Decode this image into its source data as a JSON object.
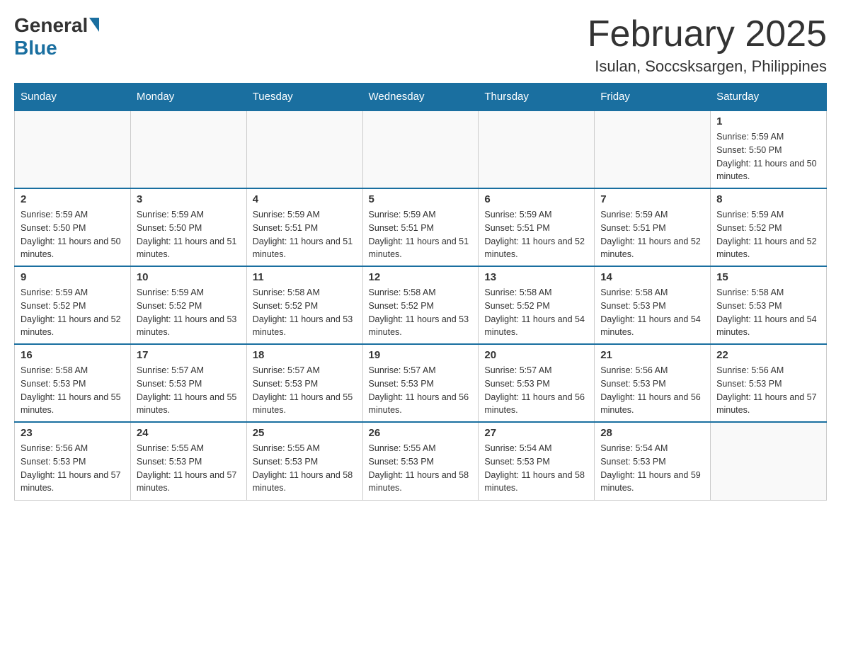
{
  "header": {
    "logo_general": "General",
    "logo_blue": "Blue",
    "month_title": "February 2025",
    "location": "Isulan, Soccsksargen, Philippines"
  },
  "calendar": {
    "days_of_week": [
      "Sunday",
      "Monday",
      "Tuesday",
      "Wednesday",
      "Thursday",
      "Friday",
      "Saturday"
    ],
    "weeks": [
      [
        {
          "day": "",
          "info": ""
        },
        {
          "day": "",
          "info": ""
        },
        {
          "day": "",
          "info": ""
        },
        {
          "day": "",
          "info": ""
        },
        {
          "day": "",
          "info": ""
        },
        {
          "day": "",
          "info": ""
        },
        {
          "day": "1",
          "sunrise": "Sunrise: 5:59 AM",
          "sunset": "Sunset: 5:50 PM",
          "daylight": "Daylight: 11 hours and 50 minutes."
        }
      ],
      [
        {
          "day": "2",
          "sunrise": "Sunrise: 5:59 AM",
          "sunset": "Sunset: 5:50 PM",
          "daylight": "Daylight: 11 hours and 50 minutes."
        },
        {
          "day": "3",
          "sunrise": "Sunrise: 5:59 AM",
          "sunset": "Sunset: 5:50 PM",
          "daylight": "Daylight: 11 hours and 51 minutes."
        },
        {
          "day": "4",
          "sunrise": "Sunrise: 5:59 AM",
          "sunset": "Sunset: 5:51 PM",
          "daylight": "Daylight: 11 hours and 51 minutes."
        },
        {
          "day": "5",
          "sunrise": "Sunrise: 5:59 AM",
          "sunset": "Sunset: 5:51 PM",
          "daylight": "Daylight: 11 hours and 51 minutes."
        },
        {
          "day": "6",
          "sunrise": "Sunrise: 5:59 AM",
          "sunset": "Sunset: 5:51 PM",
          "daylight": "Daylight: 11 hours and 52 minutes."
        },
        {
          "day": "7",
          "sunrise": "Sunrise: 5:59 AM",
          "sunset": "Sunset: 5:51 PM",
          "daylight": "Daylight: 11 hours and 52 minutes."
        },
        {
          "day": "8",
          "sunrise": "Sunrise: 5:59 AM",
          "sunset": "Sunset: 5:52 PM",
          "daylight": "Daylight: 11 hours and 52 minutes."
        }
      ],
      [
        {
          "day": "9",
          "sunrise": "Sunrise: 5:59 AM",
          "sunset": "Sunset: 5:52 PM",
          "daylight": "Daylight: 11 hours and 52 minutes."
        },
        {
          "day": "10",
          "sunrise": "Sunrise: 5:59 AM",
          "sunset": "Sunset: 5:52 PM",
          "daylight": "Daylight: 11 hours and 53 minutes."
        },
        {
          "day": "11",
          "sunrise": "Sunrise: 5:58 AM",
          "sunset": "Sunset: 5:52 PM",
          "daylight": "Daylight: 11 hours and 53 minutes."
        },
        {
          "day": "12",
          "sunrise": "Sunrise: 5:58 AM",
          "sunset": "Sunset: 5:52 PM",
          "daylight": "Daylight: 11 hours and 53 minutes."
        },
        {
          "day": "13",
          "sunrise": "Sunrise: 5:58 AM",
          "sunset": "Sunset: 5:52 PM",
          "daylight": "Daylight: 11 hours and 54 minutes."
        },
        {
          "day": "14",
          "sunrise": "Sunrise: 5:58 AM",
          "sunset": "Sunset: 5:53 PM",
          "daylight": "Daylight: 11 hours and 54 minutes."
        },
        {
          "day": "15",
          "sunrise": "Sunrise: 5:58 AM",
          "sunset": "Sunset: 5:53 PM",
          "daylight": "Daylight: 11 hours and 54 minutes."
        }
      ],
      [
        {
          "day": "16",
          "sunrise": "Sunrise: 5:58 AM",
          "sunset": "Sunset: 5:53 PM",
          "daylight": "Daylight: 11 hours and 55 minutes."
        },
        {
          "day": "17",
          "sunrise": "Sunrise: 5:57 AM",
          "sunset": "Sunset: 5:53 PM",
          "daylight": "Daylight: 11 hours and 55 minutes."
        },
        {
          "day": "18",
          "sunrise": "Sunrise: 5:57 AM",
          "sunset": "Sunset: 5:53 PM",
          "daylight": "Daylight: 11 hours and 55 minutes."
        },
        {
          "day": "19",
          "sunrise": "Sunrise: 5:57 AM",
          "sunset": "Sunset: 5:53 PM",
          "daylight": "Daylight: 11 hours and 56 minutes."
        },
        {
          "day": "20",
          "sunrise": "Sunrise: 5:57 AM",
          "sunset": "Sunset: 5:53 PM",
          "daylight": "Daylight: 11 hours and 56 minutes."
        },
        {
          "day": "21",
          "sunrise": "Sunrise: 5:56 AM",
          "sunset": "Sunset: 5:53 PM",
          "daylight": "Daylight: 11 hours and 56 minutes."
        },
        {
          "day": "22",
          "sunrise": "Sunrise: 5:56 AM",
          "sunset": "Sunset: 5:53 PM",
          "daylight": "Daylight: 11 hours and 57 minutes."
        }
      ],
      [
        {
          "day": "23",
          "sunrise": "Sunrise: 5:56 AM",
          "sunset": "Sunset: 5:53 PM",
          "daylight": "Daylight: 11 hours and 57 minutes."
        },
        {
          "day": "24",
          "sunrise": "Sunrise: 5:55 AM",
          "sunset": "Sunset: 5:53 PM",
          "daylight": "Daylight: 11 hours and 57 minutes."
        },
        {
          "day": "25",
          "sunrise": "Sunrise: 5:55 AM",
          "sunset": "Sunset: 5:53 PM",
          "daylight": "Daylight: 11 hours and 58 minutes."
        },
        {
          "day": "26",
          "sunrise": "Sunrise: 5:55 AM",
          "sunset": "Sunset: 5:53 PM",
          "daylight": "Daylight: 11 hours and 58 minutes."
        },
        {
          "day": "27",
          "sunrise": "Sunrise: 5:54 AM",
          "sunset": "Sunset: 5:53 PM",
          "daylight": "Daylight: 11 hours and 58 minutes."
        },
        {
          "day": "28",
          "sunrise": "Sunrise: 5:54 AM",
          "sunset": "Sunset: 5:53 PM",
          "daylight": "Daylight: 11 hours and 59 minutes."
        },
        {
          "day": "",
          "sunrise": "",
          "sunset": "",
          "daylight": ""
        }
      ]
    ]
  }
}
